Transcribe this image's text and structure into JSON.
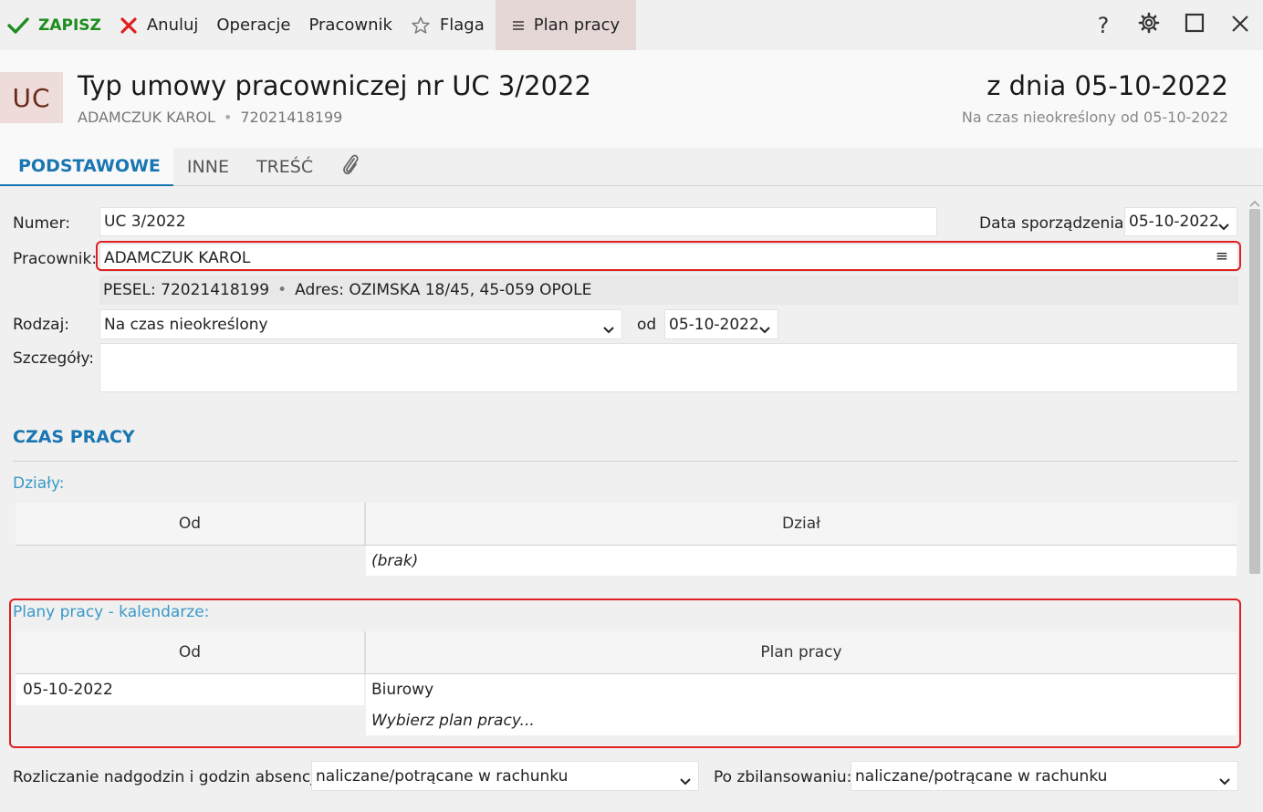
{
  "toolbar": {
    "save": "ZAPISZ",
    "cancel": "Anuluj",
    "operations": "Operacje",
    "employee": "Pracownik",
    "flag": "Flaga",
    "plan": "Plan pracy"
  },
  "window_controls": {
    "help": "?"
  },
  "header": {
    "badge": "UC",
    "title": "Typ umowy pracowniczej nr UC 3/2022",
    "employee_name": "ADAMCZUK KAROL",
    "employee_id": "72021418199",
    "date_title": "z dnia 05-10-2022",
    "date_sub": "Na czas nieokreślony od 05-10-2022"
  },
  "tabs": [
    "PODSTAWOWE",
    "INNE",
    "TREŚĆ"
  ],
  "form": {
    "number_label": "Numer:",
    "number_value": "UC 3/2022",
    "created_label": "Data sporządzenia:",
    "created_value": "05-10-2022",
    "employee_label": "Pracownik:",
    "employee_value": "ADAMCZUK KAROL",
    "employee_menu": "≡",
    "pesel_label": "PESEL:",
    "pesel_value": "72021418199",
    "address_label": "Adres:",
    "address_value": "OZIMSKA 18/45, 45-059 OPOLE",
    "type_label": "Rodzaj:",
    "type_value": "Na czas nieokreślony",
    "from_label": "od",
    "from_value": "05-10-2022",
    "details_label": "Szczegóły:",
    "details_value": ""
  },
  "work_time": {
    "title": "CZAS PRACY",
    "departments_label": "Działy:",
    "departments_cols": [
      "Od",
      "Dział"
    ],
    "departments_empty": "(brak)",
    "plans_label": "Plany pracy - kalendarze:",
    "plans_cols": [
      "Od",
      "Plan pracy"
    ],
    "plans_rows": [
      {
        "od": "05-10-2022",
        "plan": "Biurowy"
      }
    ],
    "plans_placeholder": "Wybierz plan pracy..."
  },
  "settlement": {
    "overtime_label": "Rozliczanie nadgodzin i godzin absencji:",
    "overtime_value": "naliczane/potrącane w rachunku",
    "balanced_label": "Po zbilansowaniu:",
    "balanced_value": "naliczane/potrącane w rachunku"
  },
  "colors": {
    "accent": "#1a76b2",
    "save": "#1e8c1e",
    "cancel": "#e02020",
    "highlight": "#e02020"
  }
}
